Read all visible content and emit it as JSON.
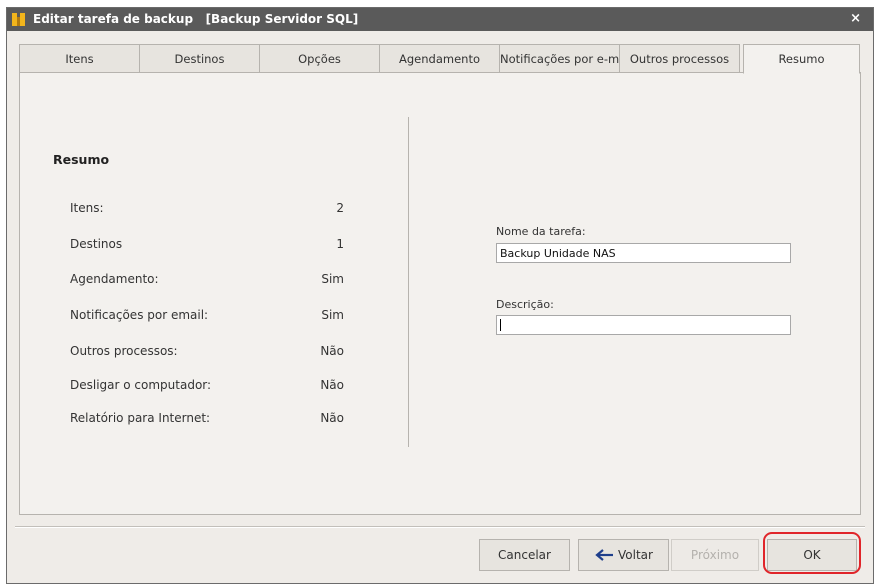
{
  "window": {
    "title": "Editar tarefa de backup   [Backup Servidor SQL]",
    "close_label": "×"
  },
  "tabs": [
    {
      "label": "Itens",
      "active": false
    },
    {
      "label": "Destinos",
      "active": false
    },
    {
      "label": "Opções",
      "active": false
    },
    {
      "label": "Agendamento",
      "active": false
    },
    {
      "label": "Notificações por e-mail",
      "active": false
    },
    {
      "label": "Outros processos",
      "active": false
    },
    {
      "label": "Resumo",
      "active": true
    }
  ],
  "summary": {
    "heading": "Resumo",
    "rows": [
      {
        "label": "Itens:",
        "value": "2"
      },
      {
        "label": "Destinos",
        "value": "1"
      },
      {
        "label": "Agendamento:",
        "value": "Sim"
      },
      {
        "label": "Notificações por email:",
        "value": "Sim"
      },
      {
        "label": "Outros processos:",
        "value": "Não"
      },
      {
        "label": "Desligar o computador:",
        "value": "Não"
      },
      {
        "label": "Relatório para Internet:",
        "value": "Não"
      }
    ]
  },
  "form": {
    "task_name_label": "Nome da tarefa:",
    "task_name_value": "Backup Unidade NAS",
    "description_label": "Descrição:",
    "description_value": ""
  },
  "buttons": {
    "cancel": "Cancelar",
    "back": "Voltar",
    "next": "Próximo",
    "ok": "OK"
  },
  "colors": {
    "titlebar": "#5a5a5a",
    "window_bg": "#efece8",
    "highlight": "#e0252a",
    "icon_yellow": "#f2b51c"
  },
  "icons": {
    "app": "folder-icon",
    "back": "arrow-left-icon"
  }
}
